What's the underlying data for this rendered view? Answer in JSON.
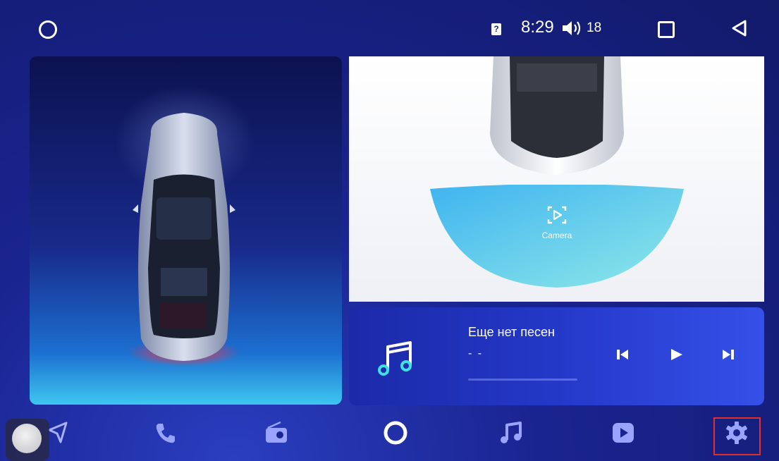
{
  "status_bar": {
    "sim_icon": "sim-unknown-icon",
    "sim_glyph": "?",
    "time": "8:29",
    "volume_icon": "volume-icon",
    "volume_level": "18",
    "recents_icon": "square-icon",
    "back_icon": "back-triangle-icon",
    "home_icon": "circle-icon"
  },
  "camera": {
    "label": "Camera",
    "icon": "camera-play-icon"
  },
  "music": {
    "title": "Еще нет песен",
    "artist": "- -",
    "progress": 0,
    "controls": {
      "prev_icon": "skip-previous-icon",
      "play_icon": "play-icon",
      "next_icon": "skip-next-icon"
    }
  },
  "dock": {
    "items": [
      {
        "name": "navigation",
        "icon": "navigation-arrow-icon"
      },
      {
        "name": "phone",
        "icon": "phone-icon"
      },
      {
        "name": "radio",
        "icon": "radio-icon"
      },
      {
        "name": "home",
        "icon": "home-circle-icon"
      },
      {
        "name": "music",
        "icon": "music-note-icon"
      },
      {
        "name": "video",
        "icon": "video-play-icon"
      },
      {
        "name": "settings",
        "icon": "gear-icon"
      }
    ]
  },
  "colors": {
    "background": "#121a6a",
    "accent_cyan": "#3ec6f0",
    "highlight_red": "#e0302c"
  }
}
